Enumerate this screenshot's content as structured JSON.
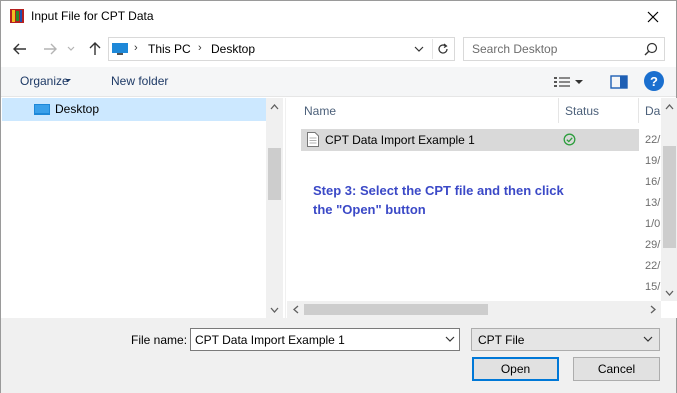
{
  "window": {
    "title": "Input File for CPT Data"
  },
  "address": {
    "segments": [
      "This PC",
      "Desktop"
    ]
  },
  "search": {
    "placeholder": "Search Desktop"
  },
  "toolbar": {
    "organize_label": "Organize",
    "new_folder_label": "New folder"
  },
  "navpane": {
    "items": [
      {
        "label": "Desktop",
        "icon": "desktop-icon",
        "selected": true
      }
    ]
  },
  "filelist": {
    "columns": [
      "Name",
      "Status",
      "Da"
    ],
    "rows": [
      {
        "name": "CPT Data Import Example 1",
        "status_icon": "check-circle-icon",
        "date": "22/"
      }
    ],
    "more_dates": [
      "19/",
      "16/",
      "13/",
      "1/0",
      "29/",
      "22/",
      "15/"
    ],
    "annotation": "Step 3: Select the CPT file and then click the \"Open\" button"
  },
  "footer": {
    "file_name_label": "File name:",
    "file_name_value": "CPT Data Import Example 1",
    "file_type": "CPT File",
    "open_label": "Open",
    "cancel_label": "Cancel"
  },
  "colors": {
    "accent": "#0078d7",
    "selection": "#cce8ff",
    "annotation": "#3b49c7",
    "status_ok": "#2e9e3e"
  }
}
